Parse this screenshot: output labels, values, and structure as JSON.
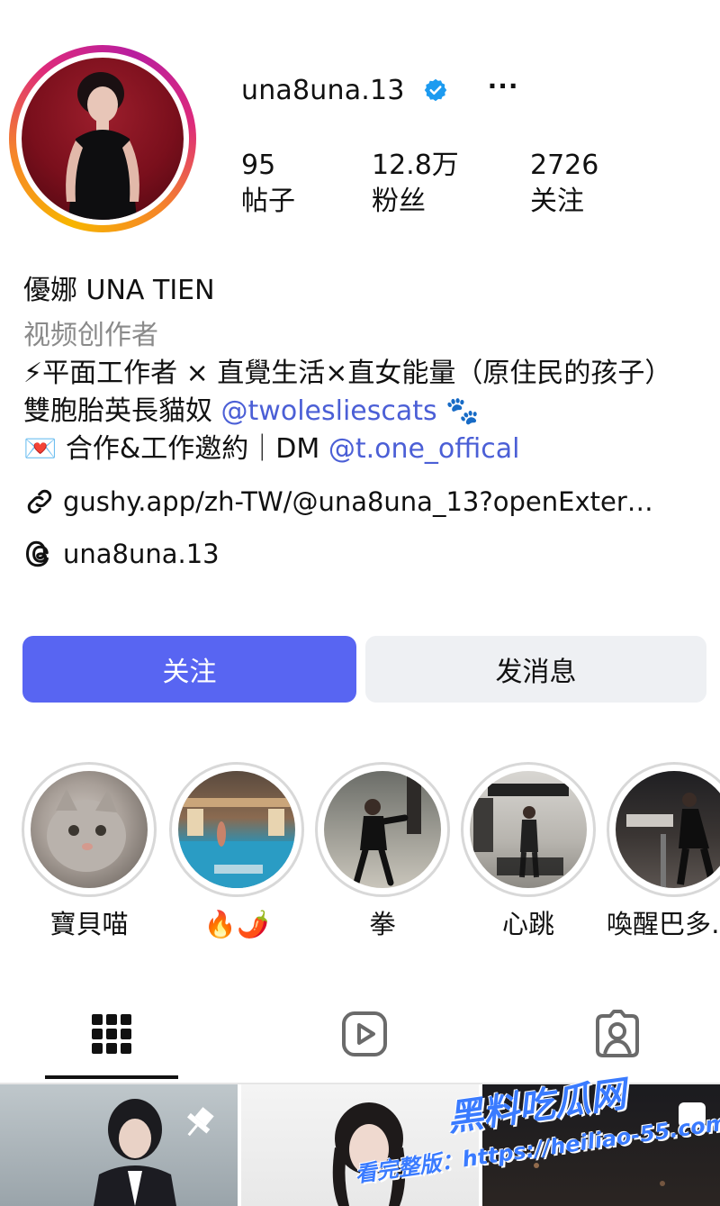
{
  "profile": {
    "username": "una8una.13",
    "more_label": "···",
    "stats": [
      {
        "value": "95",
        "label": "帖子"
      },
      {
        "value": "12.8万",
        "label": "粉丝"
      },
      {
        "value": "2726",
        "label": "关注"
      }
    ]
  },
  "bio": {
    "name": "優娜 UNA TIEN",
    "category": "视频创作者",
    "line1": "⚡平面工作者 × 直覺生活×直女能量（原住民的孩子）",
    "line2_text": "雙胞胎英長貓奴 ",
    "line2_mention": "@twolesliescats",
    "line2_emoji": " 🐾",
    "line3_text": "💌 合作&工作邀約｜DM ",
    "line3_mention": "@t.one_offical",
    "link": "gushy.app/zh-TW/@una8una_13?openExter…",
    "threads": "una8una.13"
  },
  "buttons": {
    "follow": "关注",
    "message": "发消息"
  },
  "highlights": [
    {
      "label": "寶貝喵"
    },
    {
      "label": "🔥🌶️"
    },
    {
      "label": "拳"
    },
    {
      "label": "心跳"
    },
    {
      "label": "喚醒巴多…"
    }
  ],
  "tabs": [
    "grid-icon",
    "reels-icon",
    "tagged-icon"
  ],
  "watermark": {
    "title": "黑料吃瓜网",
    "url": "看完整版：https://heiliao-55.com"
  },
  "colors": {
    "accent": "#5865f2",
    "mention": "#4b5fd6",
    "verified": "#1d9bf0"
  }
}
